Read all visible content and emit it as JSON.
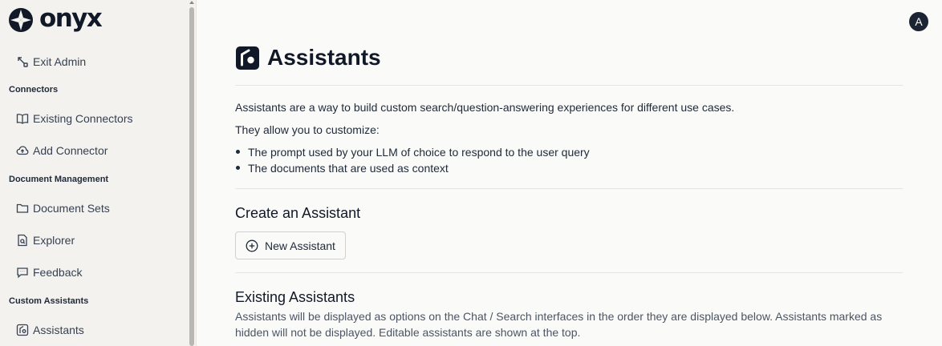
{
  "app": {
    "logo_text": "onyx"
  },
  "sidebar": {
    "exit_admin": "Exit Admin",
    "sections": [
      {
        "title": "Connectors",
        "items": [
          {
            "label": "Existing Connectors",
            "icon": "book-icon"
          },
          {
            "label": "Add Connector",
            "icon": "cloud-upload-icon"
          }
        ]
      },
      {
        "title": "Document Management",
        "items": [
          {
            "label": "Document Sets",
            "icon": "folder-icon"
          },
          {
            "label": "Explorer",
            "icon": "file-search-icon"
          },
          {
            "label": "Feedback",
            "icon": "message-icon"
          }
        ]
      },
      {
        "title": "Custom Assistants",
        "items": [
          {
            "label": "Assistants",
            "icon": "assistant-icon"
          }
        ]
      }
    ]
  },
  "user": {
    "avatar_initial": "A"
  },
  "main": {
    "title": "Assistants",
    "intro": "Assistants are a way to build custom search/question-answering experiences for different use cases.",
    "customize_lead": "They allow you to customize:",
    "bullets": [
      "The prompt used by your LLM of choice to respond to the user query",
      "The documents that are used as context"
    ],
    "create_heading": "Create an Assistant",
    "new_button": "New Assistant",
    "existing_heading": "Existing Assistants",
    "existing_desc": "Assistants will be displayed as options on the Chat / Search interfaces in the order they are displayed below. Assistants marked as hidden will not be displayed. Editable assistants are shown at the top."
  },
  "colors": {
    "accent_dark": "#1c2333",
    "sidebar_bg": "#f3f2ef",
    "page_bg": "#fafaf9"
  }
}
